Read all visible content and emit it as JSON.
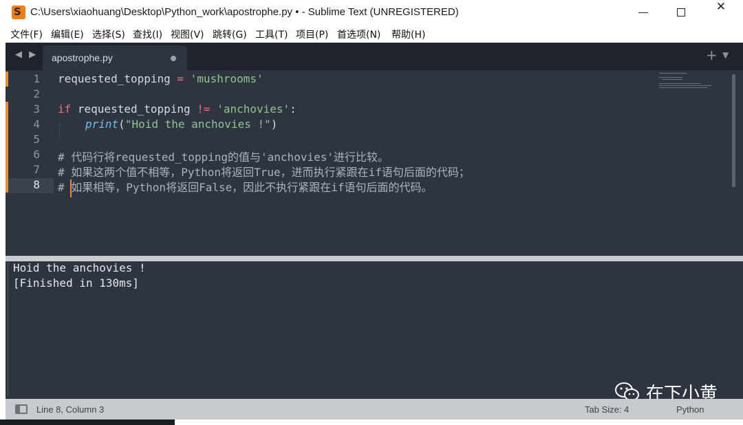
{
  "window": {
    "title": "C:\\Users\\xiaohuang\\Desktop\\Python_work\\apostrophe.py • - Sublime Text (UNREGISTERED)",
    "app_icon_glyph": "S",
    "minimize": "minimize-icon",
    "maximize": "maximize-icon",
    "close_glyph": "✕"
  },
  "menu": [
    "文件(F)",
    "编辑(E)",
    "选择(S)",
    "查找(I)",
    "视图(V)",
    "跳转(G)",
    "工具(T)",
    "项目(P)",
    "首选项(N)",
    "帮助(H)"
  ],
  "tabs": {
    "nav": "◀ ▶",
    "active_label": "apostrophe.py",
    "new_tab": "+",
    "dropdown": "▼"
  },
  "editor": {
    "line_numbers": [
      "1",
      "2",
      "3",
      "4",
      "5",
      "6",
      "7",
      "8"
    ],
    "current_line": "8",
    "lines": {
      "l1_var": "requested_topping ",
      "l1_op": "=",
      "l1_str": " 'mushrooms'",
      "l3_kw": "if",
      "l3_var": " requested_topping ",
      "l3_op": "!=",
      "l3_str": " 'anchovies'",
      "l3_colon": ":",
      "l4_fn": "print",
      "l4_open": "(",
      "l4_str": "\"Hoid the anchovies !\"",
      "l4_close": ")",
      "l6": "# 代码行将requested_topping的值与'anchovies'进行比较。",
      "l7": "# 如果这两个值不相等，Python将返回True，进而执行紧跟在if语句后面的代码；",
      "l8": "# 如果相等，Python将返回False，因此不执行紧跟在if语句后面的代码。"
    }
  },
  "output": {
    "lines": [
      "Hoid the anchovies !",
      "[Finished in 130ms]"
    ]
  },
  "watermark": {
    "text": "在下小黄",
    "icon": "wechat-icon"
  },
  "status": {
    "position": "Line 8, Column 3",
    "tab_size": "Tab Size: 4",
    "syntax": "Python"
  },
  "colors": {
    "editor_bg": "#2e3540",
    "keyword": "#f07178",
    "string": "#8cc88c",
    "function": "#6ec0f0",
    "modified_marker": "#e0913a"
  }
}
